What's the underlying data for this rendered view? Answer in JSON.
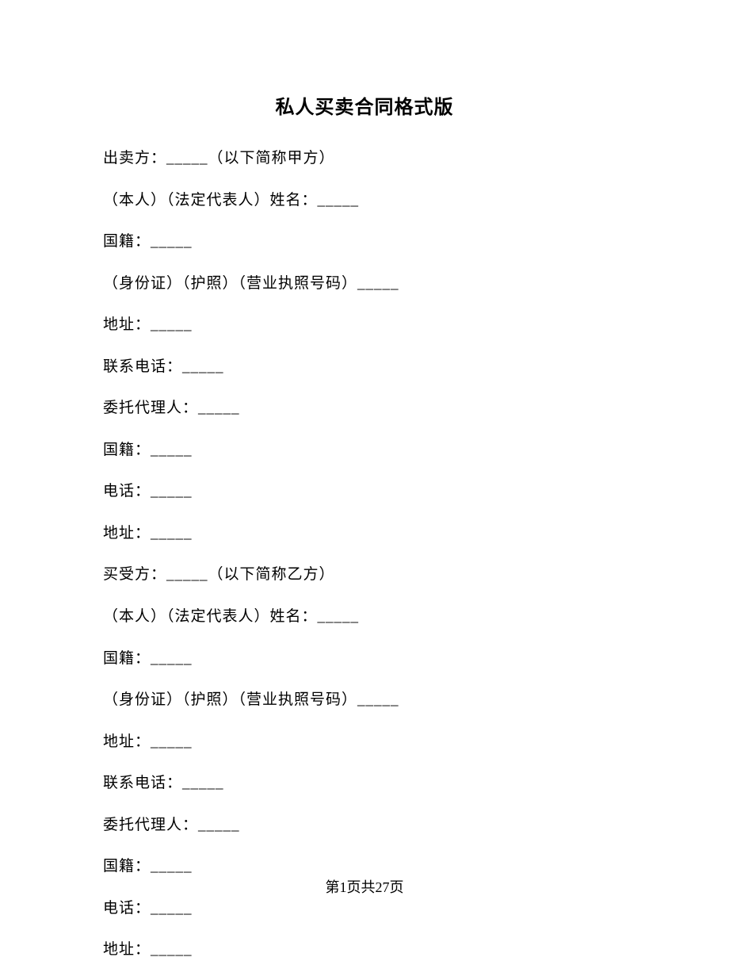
{
  "title": "私人买卖合同格式版",
  "lines": [
    "出卖方：_____（以下简称甲方）",
    "（本人）（法定代表人）姓名：_____",
    "国籍：_____",
    "（身份证）（护照）（营业执照号码）_____",
    "地址：_____",
    "联系电话：_____",
    "委托代理人：_____",
    "国籍：_____",
    "电话：_____",
    "地址：_____",
    "买受方：_____（以下简称乙方）",
    "（本人）（法定代表人）姓名：_____",
    "国籍：_____",
    "（身份证）（护照）（营业执照号码）_____",
    "地址：_____",
    "联系电话：_____",
    "委托代理人：_____",
    "国籍：_____",
    "电话：_____",
    "地址：_____"
  ],
  "footer": "第1页共27页"
}
